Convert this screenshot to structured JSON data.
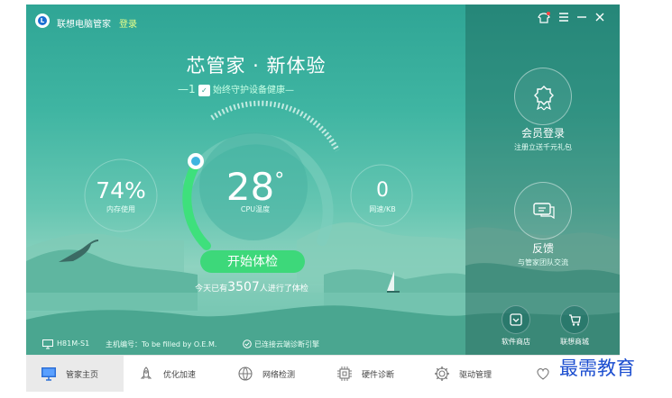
{
  "window": {
    "app_title": "联想电脑管家",
    "login_link": "登录"
  },
  "hero": {
    "headline": "芯管家 · 新体验",
    "sub_prefix": "—1",
    "sub_text": "始终守护设备健康—"
  },
  "gauges": {
    "memory": {
      "value": "74%",
      "label": "内存使用"
    },
    "cpu": {
      "value": "28",
      "unit": "°",
      "label": "CPU温度"
    },
    "network": {
      "value": "0",
      "label": "网速/KB"
    }
  },
  "action": {
    "start_button": "开始体检",
    "count_prefix": "今天已有",
    "count_value": "3507",
    "count_suffix": "人进行了体检"
  },
  "right_panel": {
    "member": {
      "title": "会员登录",
      "subtitle": "注册立送千元礼包"
    },
    "feedback": {
      "title": "反馈",
      "subtitle": "与管家团队交流"
    },
    "software_store": "软件商店",
    "lenovo_mall": "联想商城"
  },
  "status": {
    "model": "H81M-S1",
    "serial": "主机编号：To be filled by O.E.M.",
    "connected": "已连接云端诊断引擎"
  },
  "nav": [
    {
      "label": "管家主页",
      "icon": "monitor-icon"
    },
    {
      "label": "优化加速",
      "icon": "rocket-icon"
    },
    {
      "label": "网络检测",
      "icon": "network-icon"
    },
    {
      "label": "硬件诊断",
      "icon": "chip-icon"
    },
    {
      "label": "驱动管理",
      "icon": "gear-icon"
    },
    {
      "label": "",
      "icon": "heart-icon"
    }
  ],
  "watermark": "最需教育",
  "colors": {
    "accent_green": "#3dd87a",
    "login_link": "#e8ff8a",
    "watermark_blue": "#1d4fd0"
  }
}
